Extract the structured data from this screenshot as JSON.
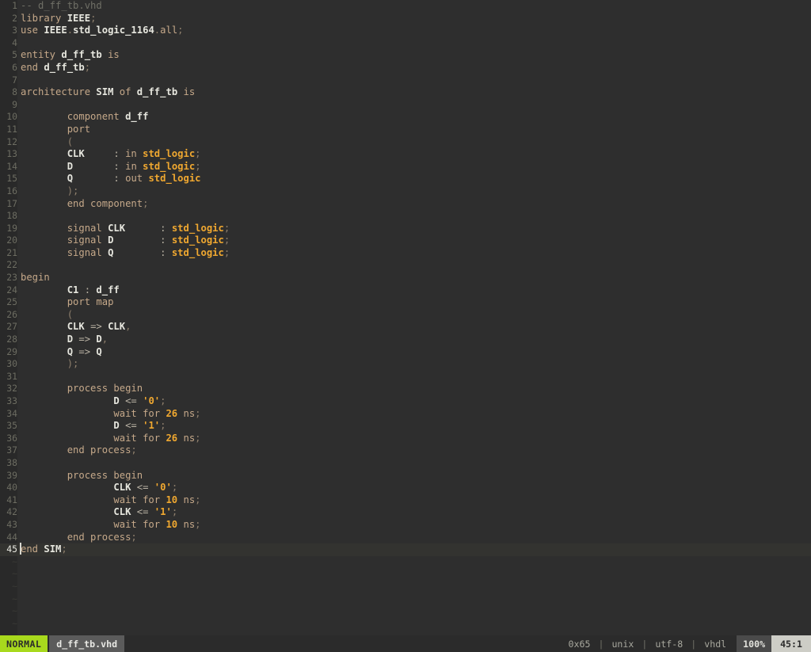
{
  "editor": {
    "gutter_start": 1,
    "total_lines": 45,
    "cursor_line": 45,
    "cursor_col": 1,
    "tilde_rows": 6,
    "lines": [
      {
        "n": "1",
        "tokens": [
          {
            "t": "com",
            "s": "-- d_ff_tb.vhd"
          }
        ]
      },
      {
        "n": "2",
        "tokens": [
          {
            "t": "kw",
            "s": "library"
          },
          {
            "t": "pl",
            "s": " "
          },
          {
            "t": "id",
            "s": "IEEE"
          },
          {
            "t": "pun",
            "s": ";"
          }
        ]
      },
      {
        "n": "3",
        "tokens": [
          {
            "t": "kw",
            "s": "use"
          },
          {
            "t": "pl",
            "s": " "
          },
          {
            "t": "id",
            "s": "IEEE"
          },
          {
            "t": "pun",
            "s": "."
          },
          {
            "t": "id",
            "s": "std_logic_1164"
          },
          {
            "t": "pun",
            "s": "."
          },
          {
            "t": "kw",
            "s": "all"
          },
          {
            "t": "pun",
            "s": ";"
          }
        ]
      },
      {
        "n": "4",
        "tokens": []
      },
      {
        "n": "5",
        "tokens": [
          {
            "t": "kw",
            "s": "entity"
          },
          {
            "t": "pl",
            "s": " "
          },
          {
            "t": "id",
            "s": "d_ff_tb"
          },
          {
            "t": "pl",
            "s": " "
          },
          {
            "t": "kw",
            "s": "is"
          }
        ]
      },
      {
        "n": "6",
        "tokens": [
          {
            "t": "kw",
            "s": "end"
          },
          {
            "t": "pl",
            "s": " "
          },
          {
            "t": "id",
            "s": "d_ff_tb"
          },
          {
            "t": "pun",
            "s": ";"
          }
        ]
      },
      {
        "n": "7",
        "tokens": []
      },
      {
        "n": "8",
        "tokens": [
          {
            "t": "kw",
            "s": "architecture"
          },
          {
            "t": "pl",
            "s": " "
          },
          {
            "t": "id",
            "s": "SIM"
          },
          {
            "t": "pl",
            "s": " "
          },
          {
            "t": "kw",
            "s": "of"
          },
          {
            "t": "pl",
            "s": " "
          },
          {
            "t": "id",
            "s": "d_ff_tb"
          },
          {
            "t": "pl",
            "s": " "
          },
          {
            "t": "kw",
            "s": "is"
          }
        ]
      },
      {
        "n": "9",
        "tokens": []
      },
      {
        "n": "10",
        "tokens": [
          {
            "t": "pl",
            "s": "        "
          },
          {
            "t": "kw",
            "s": "component"
          },
          {
            "t": "pl",
            "s": " "
          },
          {
            "t": "id",
            "s": "d_ff"
          }
        ]
      },
      {
        "n": "11",
        "tokens": [
          {
            "t": "pl",
            "s": "        "
          },
          {
            "t": "kw",
            "s": "port"
          }
        ]
      },
      {
        "n": "12",
        "tokens": [
          {
            "t": "pl",
            "s": "        "
          },
          {
            "t": "pun",
            "s": "("
          }
        ]
      },
      {
        "n": "13",
        "tokens": [
          {
            "t": "pl",
            "s": "        "
          },
          {
            "t": "id",
            "s": "CLK"
          },
          {
            "t": "pl",
            "s": "     "
          },
          {
            "t": "op",
            "s": ":"
          },
          {
            "t": "pl",
            "s": " "
          },
          {
            "t": "kw",
            "s": "in"
          },
          {
            "t": "pl",
            "s": " "
          },
          {
            "t": "typ",
            "s": "std_logic"
          },
          {
            "t": "pun",
            "s": ";"
          }
        ]
      },
      {
        "n": "14",
        "tokens": [
          {
            "t": "pl",
            "s": "        "
          },
          {
            "t": "id",
            "s": "D"
          },
          {
            "t": "pl",
            "s": "       "
          },
          {
            "t": "op",
            "s": ":"
          },
          {
            "t": "pl",
            "s": " "
          },
          {
            "t": "kw",
            "s": "in"
          },
          {
            "t": "pl",
            "s": " "
          },
          {
            "t": "typ",
            "s": "std_logic"
          },
          {
            "t": "pun",
            "s": ";"
          }
        ]
      },
      {
        "n": "15",
        "tokens": [
          {
            "t": "pl",
            "s": "        "
          },
          {
            "t": "id",
            "s": "Q"
          },
          {
            "t": "pl",
            "s": "       "
          },
          {
            "t": "op",
            "s": ":"
          },
          {
            "t": "pl",
            "s": " "
          },
          {
            "t": "kw",
            "s": "out"
          },
          {
            "t": "pl",
            "s": " "
          },
          {
            "t": "typ",
            "s": "std_logic"
          }
        ]
      },
      {
        "n": "16",
        "tokens": [
          {
            "t": "pl",
            "s": "        "
          },
          {
            "t": "pun",
            "s": ");"
          }
        ]
      },
      {
        "n": "17",
        "tokens": [
          {
            "t": "pl",
            "s": "        "
          },
          {
            "t": "kw",
            "s": "end component"
          },
          {
            "t": "pun",
            "s": ";"
          }
        ]
      },
      {
        "n": "18",
        "tokens": []
      },
      {
        "n": "19",
        "tokens": [
          {
            "t": "pl",
            "s": "        "
          },
          {
            "t": "kw",
            "s": "signal"
          },
          {
            "t": "pl",
            "s": " "
          },
          {
            "t": "id",
            "s": "CLK"
          },
          {
            "t": "pl",
            "s": "      "
          },
          {
            "t": "op",
            "s": ":"
          },
          {
            "t": "pl",
            "s": " "
          },
          {
            "t": "typ",
            "s": "std_logic"
          },
          {
            "t": "pun",
            "s": ";"
          }
        ]
      },
      {
        "n": "20",
        "tokens": [
          {
            "t": "pl",
            "s": "        "
          },
          {
            "t": "kw",
            "s": "signal"
          },
          {
            "t": "pl",
            "s": " "
          },
          {
            "t": "id",
            "s": "D"
          },
          {
            "t": "pl",
            "s": "        "
          },
          {
            "t": "op",
            "s": ":"
          },
          {
            "t": "pl",
            "s": " "
          },
          {
            "t": "typ",
            "s": "std_logic"
          },
          {
            "t": "pun",
            "s": ";"
          }
        ]
      },
      {
        "n": "21",
        "tokens": [
          {
            "t": "pl",
            "s": "        "
          },
          {
            "t": "kw",
            "s": "signal"
          },
          {
            "t": "pl",
            "s": " "
          },
          {
            "t": "id",
            "s": "Q"
          },
          {
            "t": "pl",
            "s": "        "
          },
          {
            "t": "op",
            "s": ":"
          },
          {
            "t": "pl",
            "s": " "
          },
          {
            "t": "typ",
            "s": "std_logic"
          },
          {
            "t": "pun",
            "s": ";"
          }
        ]
      },
      {
        "n": "22",
        "tokens": []
      },
      {
        "n": "23",
        "tokens": [
          {
            "t": "kw",
            "s": "begin"
          }
        ]
      },
      {
        "n": "24",
        "tokens": [
          {
            "t": "pl",
            "s": "        "
          },
          {
            "t": "id",
            "s": "C1"
          },
          {
            "t": "pl",
            "s": " "
          },
          {
            "t": "op",
            "s": ":"
          },
          {
            "t": "pl",
            "s": " "
          },
          {
            "t": "id",
            "s": "d_ff"
          }
        ]
      },
      {
        "n": "25",
        "tokens": [
          {
            "t": "pl",
            "s": "        "
          },
          {
            "t": "kw",
            "s": "port map"
          }
        ]
      },
      {
        "n": "26",
        "tokens": [
          {
            "t": "pl",
            "s": "        "
          },
          {
            "t": "pun",
            "s": "("
          }
        ]
      },
      {
        "n": "27",
        "tokens": [
          {
            "t": "pl",
            "s": "        "
          },
          {
            "t": "id",
            "s": "CLK"
          },
          {
            "t": "pl",
            "s": " "
          },
          {
            "t": "op",
            "s": "=>"
          },
          {
            "t": "pl",
            "s": " "
          },
          {
            "t": "id",
            "s": "CLK"
          },
          {
            "t": "pun",
            "s": ","
          }
        ]
      },
      {
        "n": "28",
        "tokens": [
          {
            "t": "pl",
            "s": "        "
          },
          {
            "t": "id",
            "s": "D"
          },
          {
            "t": "pl",
            "s": " "
          },
          {
            "t": "op",
            "s": "=>"
          },
          {
            "t": "pl",
            "s": " "
          },
          {
            "t": "id",
            "s": "D"
          },
          {
            "t": "pun",
            "s": ","
          }
        ]
      },
      {
        "n": "29",
        "tokens": [
          {
            "t": "pl",
            "s": "        "
          },
          {
            "t": "id",
            "s": "Q"
          },
          {
            "t": "pl",
            "s": " "
          },
          {
            "t": "op",
            "s": "=>"
          },
          {
            "t": "pl",
            "s": " "
          },
          {
            "t": "id",
            "s": "Q"
          }
        ]
      },
      {
        "n": "30",
        "tokens": [
          {
            "t": "pl",
            "s": "        "
          },
          {
            "t": "pun",
            "s": ");"
          }
        ]
      },
      {
        "n": "31",
        "tokens": []
      },
      {
        "n": "32",
        "tokens": [
          {
            "t": "pl",
            "s": "        "
          },
          {
            "t": "kw",
            "s": "process begin"
          }
        ]
      },
      {
        "n": "33",
        "tokens": [
          {
            "t": "pl",
            "s": "                "
          },
          {
            "t": "id",
            "s": "D"
          },
          {
            "t": "pl",
            "s": " "
          },
          {
            "t": "op",
            "s": "<="
          },
          {
            "t": "pl",
            "s": " "
          },
          {
            "t": "num",
            "s": "'0'"
          },
          {
            "t": "pun",
            "s": ";"
          }
        ]
      },
      {
        "n": "34",
        "tokens": [
          {
            "t": "pl",
            "s": "                "
          },
          {
            "t": "kw",
            "s": "wait for"
          },
          {
            "t": "pl",
            "s": " "
          },
          {
            "t": "num",
            "s": "26"
          },
          {
            "t": "pl",
            "s": " "
          },
          {
            "t": "kw",
            "s": "ns"
          },
          {
            "t": "pun",
            "s": ";"
          }
        ]
      },
      {
        "n": "35",
        "tokens": [
          {
            "t": "pl",
            "s": "                "
          },
          {
            "t": "id",
            "s": "D"
          },
          {
            "t": "pl",
            "s": " "
          },
          {
            "t": "op",
            "s": "<="
          },
          {
            "t": "pl",
            "s": " "
          },
          {
            "t": "num",
            "s": "'1'"
          },
          {
            "t": "pun",
            "s": ";"
          }
        ]
      },
      {
        "n": "36",
        "tokens": [
          {
            "t": "pl",
            "s": "                "
          },
          {
            "t": "kw",
            "s": "wait for"
          },
          {
            "t": "pl",
            "s": " "
          },
          {
            "t": "num",
            "s": "26"
          },
          {
            "t": "pl",
            "s": " "
          },
          {
            "t": "kw",
            "s": "ns"
          },
          {
            "t": "pun",
            "s": ";"
          }
        ]
      },
      {
        "n": "37",
        "tokens": [
          {
            "t": "pl",
            "s": "        "
          },
          {
            "t": "kw",
            "s": "end process"
          },
          {
            "t": "pun",
            "s": ";"
          }
        ]
      },
      {
        "n": "38",
        "tokens": []
      },
      {
        "n": "39",
        "tokens": [
          {
            "t": "pl",
            "s": "        "
          },
          {
            "t": "kw",
            "s": "process begin"
          }
        ]
      },
      {
        "n": "40",
        "tokens": [
          {
            "t": "pl",
            "s": "                "
          },
          {
            "t": "id",
            "s": "CLK"
          },
          {
            "t": "pl",
            "s": " "
          },
          {
            "t": "op",
            "s": "<="
          },
          {
            "t": "pl",
            "s": " "
          },
          {
            "t": "num",
            "s": "'0'"
          },
          {
            "t": "pun",
            "s": ";"
          }
        ]
      },
      {
        "n": "41",
        "tokens": [
          {
            "t": "pl",
            "s": "                "
          },
          {
            "t": "kw",
            "s": "wait for"
          },
          {
            "t": "pl",
            "s": " "
          },
          {
            "t": "num",
            "s": "10"
          },
          {
            "t": "pl",
            "s": " "
          },
          {
            "t": "kw",
            "s": "ns"
          },
          {
            "t": "pun",
            "s": ";"
          }
        ]
      },
      {
        "n": "42",
        "tokens": [
          {
            "t": "pl",
            "s": "                "
          },
          {
            "t": "id",
            "s": "CLK"
          },
          {
            "t": "pl",
            "s": " "
          },
          {
            "t": "op",
            "s": "<="
          },
          {
            "t": "pl",
            "s": " "
          },
          {
            "t": "num",
            "s": "'1'"
          },
          {
            "t": "pun",
            "s": ";"
          }
        ]
      },
      {
        "n": "43",
        "tokens": [
          {
            "t": "pl",
            "s": "                "
          },
          {
            "t": "kw",
            "s": "wait for"
          },
          {
            "t": "pl",
            "s": " "
          },
          {
            "t": "num",
            "s": "10"
          },
          {
            "t": "pl",
            "s": " "
          },
          {
            "t": "kw",
            "s": "ns"
          },
          {
            "t": "pun",
            "s": ";"
          }
        ]
      },
      {
        "n": "44",
        "tokens": [
          {
            "t": "pl",
            "s": "        "
          },
          {
            "t": "kw",
            "s": "end process"
          },
          {
            "t": "pun",
            "s": ";"
          }
        ]
      },
      {
        "n": "45",
        "cursor": true,
        "tokens": [
          {
            "t": "kw",
            "s": "end"
          },
          {
            "t": "pl",
            "s": " "
          },
          {
            "t": "id",
            "s": "SIM"
          },
          {
            "t": "pun",
            "s": ";"
          }
        ]
      }
    ]
  },
  "statusline": {
    "mode": "NORMAL",
    "filename": "d_ff_tb.vhd",
    "hexcode": "0x65",
    "fileformat": "unix",
    "encoding": "utf-8",
    "filetype": "vhdl",
    "percent": "100%",
    "position": "45:1",
    "separator": "|"
  },
  "colors": {
    "background": "#2e2e2e",
    "gutter_background": "#292929",
    "cursorline_background": "#333330",
    "mode_badge": "#a8d91d",
    "file_badge": "#5b5b5b",
    "percent_badge": "#4a4a4a",
    "position_badge": "#cdcdc6",
    "keyword": "#c6a98a",
    "identifier": "#e6e6de",
    "type": "#f0a830",
    "number": "#f0a830",
    "comment": "#6f6f66",
    "linenumber": "#6d6d62"
  }
}
